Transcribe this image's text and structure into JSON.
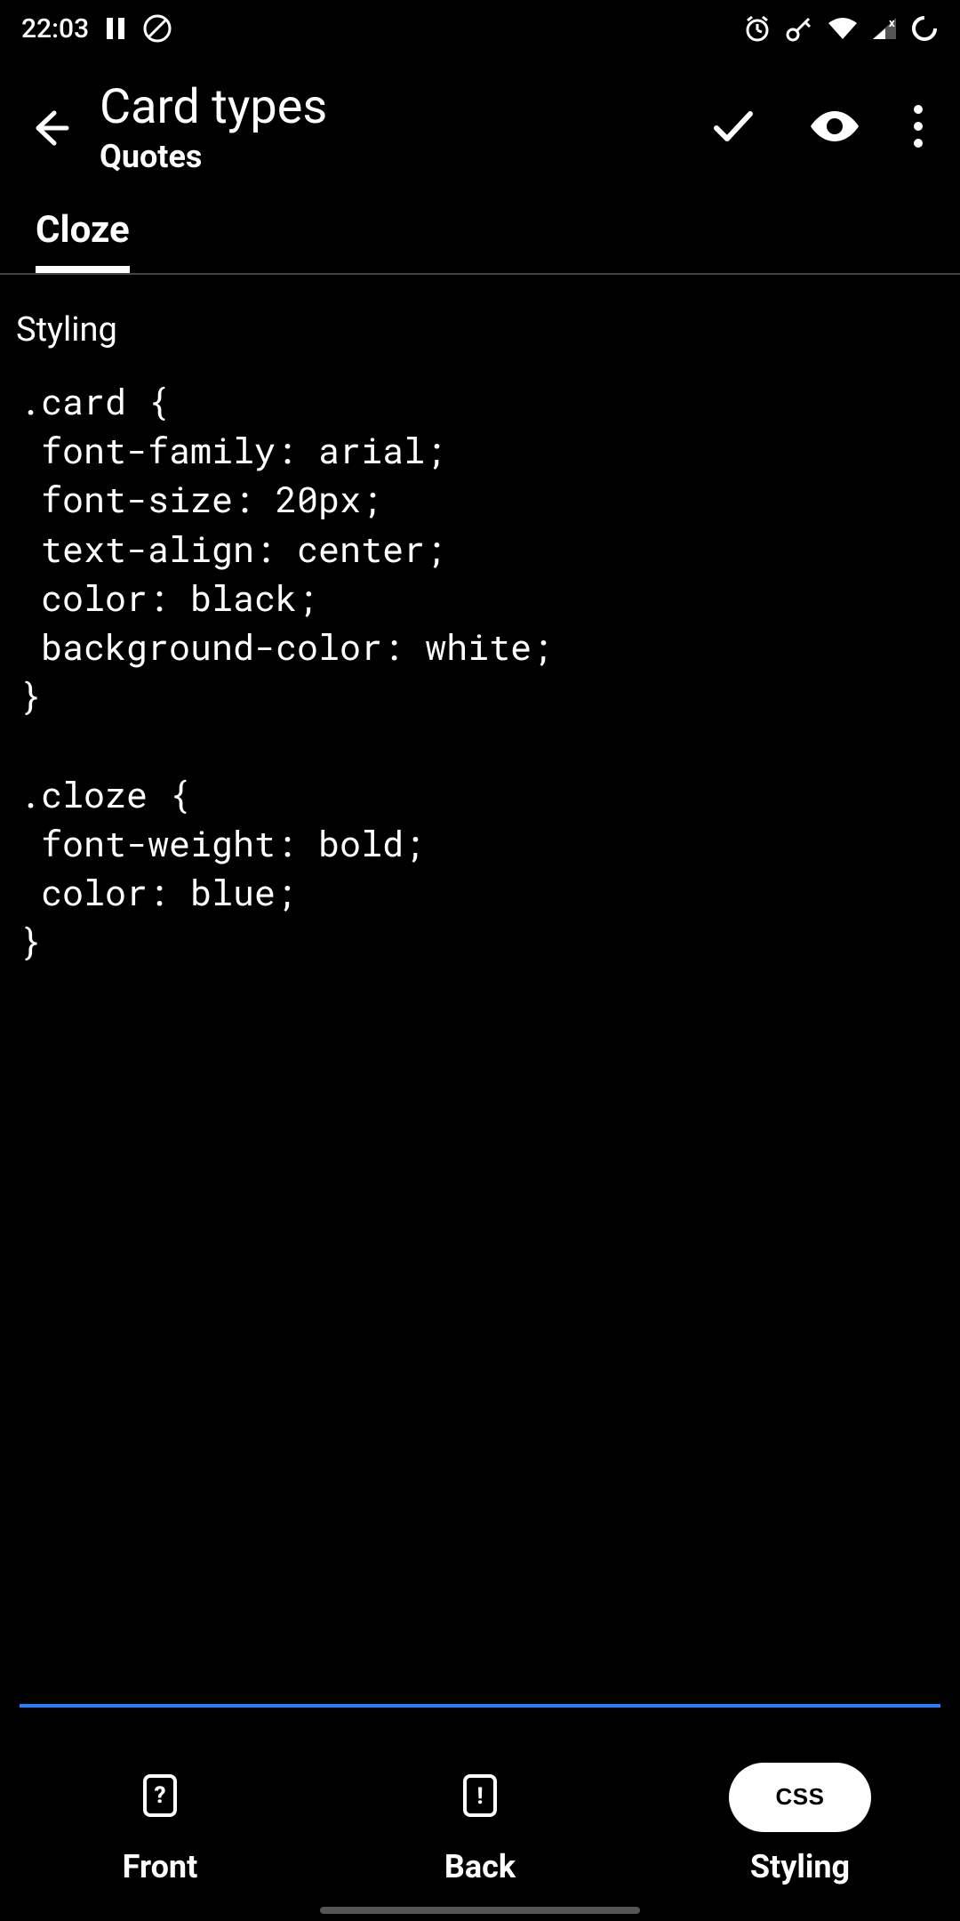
{
  "status": {
    "time": "22:03"
  },
  "header": {
    "title": "Card types",
    "subtitle": "Quotes"
  },
  "tabs": {
    "active": "Cloze"
  },
  "section_label": "Styling",
  "editor_value": ".card {\n font-family: arial;\n font-size: 20px;\n text-align: center;\n color: black;\n background-color: white;\n}\n\n.cloze {\n font-weight: bold;\n color: blue;\n}",
  "bottom_nav": {
    "front": "Front",
    "back": "Back",
    "styling": "Styling",
    "css_badge": "CSS"
  }
}
